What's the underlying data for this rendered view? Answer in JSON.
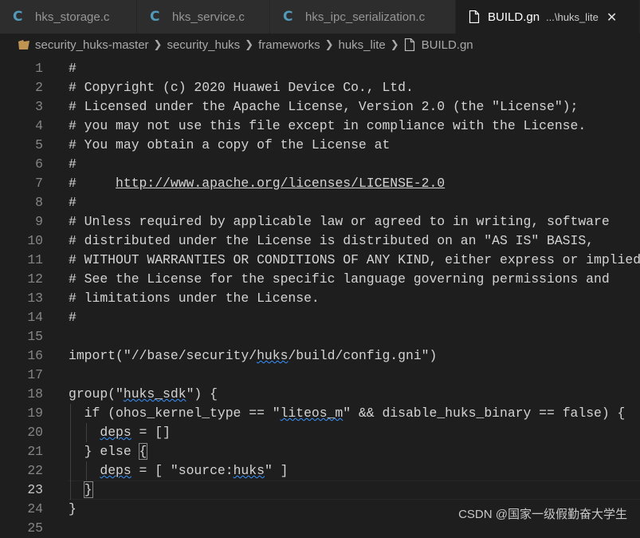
{
  "tabs": [
    {
      "label": "hks_storage.c",
      "icon": "C",
      "active": false
    },
    {
      "label": "hks_service.c",
      "icon": "C",
      "active": false
    },
    {
      "label": "hks_ipc_serialization.c",
      "icon": "C",
      "active": false
    },
    {
      "label": "BUILD.gn",
      "description": "...\\huks_lite",
      "active": true
    }
  ],
  "breadcrumb": [
    "security_huks-master",
    "security_huks",
    "frameworks",
    "huks_lite",
    "BUILD.gn"
  ],
  "editor": {
    "current_line": 23,
    "lines": [
      "#",
      "# Copyright (c) 2020 Huawei Device Co., Ltd.",
      "# Licensed under the Apache License, Version 2.0 (the \"License\");",
      "# you may not use this file except in compliance with the License.",
      "# You may obtain a copy of the License at",
      "#",
      "#     http://www.apache.org/licenses/LICENSE-2.0",
      "#",
      "# Unless required by applicable law or agreed to in writing, software",
      "# distributed under the License is distributed on an \"AS IS\" BASIS,",
      "# WITHOUT WARRANTIES OR CONDITIONS OF ANY KIND, either express or implied.",
      "# See the License for the specific language governing permissions and",
      "# limitations under the License.",
      "#",
      "",
      "import(\"//base/security/huks/build/config.gni\")",
      "",
      "group(\"huks_sdk\") {",
      "  if (ohos_kernel_type == \"liteos_m\" && disable_huks_binary == false) {",
      "    deps = []",
      "  } else {",
      "    deps = [ \"source:huks\" ]",
      "  }",
      "}",
      ""
    ]
  },
  "watermark": "CSDN @国家一级假勤奋大学生"
}
